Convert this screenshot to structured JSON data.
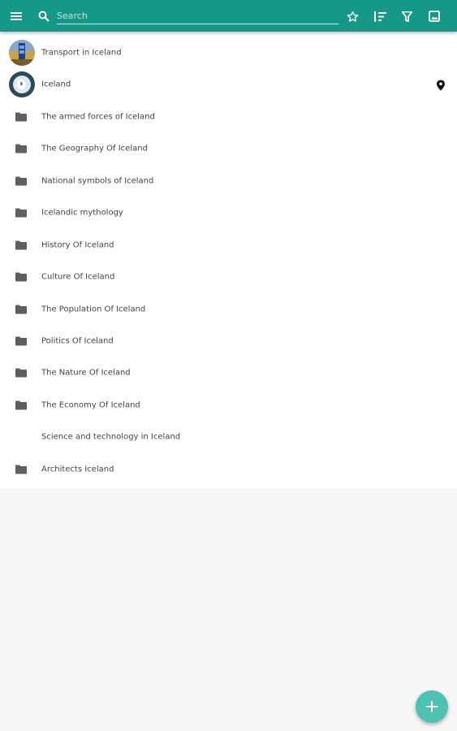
{
  "toolbar": {
    "menu_icon": "menu-icon",
    "search_icon": "search-icon",
    "search_placeholder": "Search",
    "search_value": "",
    "actions": [
      "star-icon",
      "sort-icon",
      "filter-icon",
      "image-icon"
    ]
  },
  "colors": {
    "appbar": "#159886",
    "fab": "#4fc1b2",
    "folder_icon": "#5f5f5f",
    "text": "#444444",
    "background": "#f6f6f6"
  },
  "list": {
    "items": [
      {
        "label": "Transport in Iceland",
        "icon": "thumbnail-transport"
      },
      {
        "label": "Iceland",
        "icon": "thumbnail-iceland",
        "trailing_icon": "location-pin-icon"
      },
      {
        "label": "The armed forces of Iceland",
        "icon": "folder-icon"
      },
      {
        "label": "The Geography Of Iceland",
        "icon": "folder-icon"
      },
      {
        "label": "National symbols of Iceland",
        "icon": "folder-icon"
      },
      {
        "label": "Icelandic mythology",
        "icon": "folder-icon"
      },
      {
        "label": "History Of Iceland",
        "icon": "folder-icon"
      },
      {
        "label": "Culture Of Iceland",
        "icon": "folder-icon"
      },
      {
        "label": "The Population Of Iceland",
        "icon": "folder-icon"
      },
      {
        "label": "Politics Of Iceland",
        "icon": "folder-icon"
      },
      {
        "label": "The Nature Of Iceland",
        "icon": "folder-icon"
      },
      {
        "label": "The Economy Of Iceland",
        "icon": "folder-icon"
      },
      {
        "label": "Science and technology in Iceland",
        "icon": ""
      },
      {
        "label": "Architects Iceland",
        "icon": "folder-icon"
      }
    ]
  },
  "fab": {
    "icon": "add-icon"
  }
}
